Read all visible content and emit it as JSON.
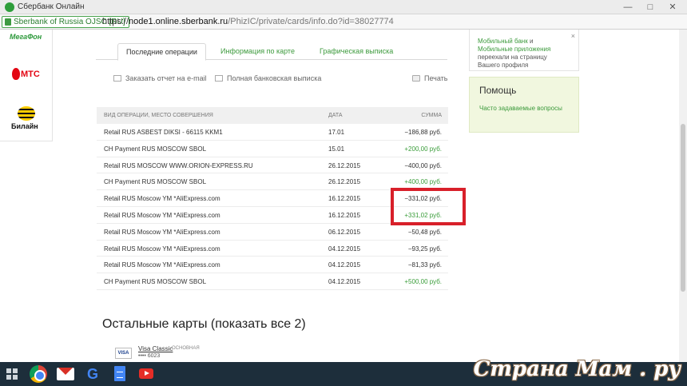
{
  "window": {
    "title": "Сбербанк Онлайн",
    "controls": {
      "minimize": "—",
      "maximize": "□",
      "close": "✕"
    }
  },
  "address_bar": {
    "security_badge": "Sberbank of Russia OJSC [RU]",
    "url_scheme": "https://",
    "url_host": "node1.online.sberbank.ru",
    "url_path": "/PhizIC/private/cards/info.do?id=38027774"
  },
  "ads": {
    "megafon": "МегаФон",
    "mts": "МТС",
    "beeline": "Билайн"
  },
  "tabs": [
    {
      "label": "Последние операции",
      "active": true
    },
    {
      "label": "Информация по карте",
      "active": false
    },
    {
      "label": "Графическая выписка",
      "active": false
    }
  ],
  "actions": {
    "email_report": "Заказать отчет на e-mail",
    "full_statement": "Полная банковская выписка",
    "print": "Печать"
  },
  "table": {
    "headers": {
      "operation": "ВИД ОПЕРАЦИИ, МЕСТО СОВЕРШЕНИЯ",
      "date": "ДАТА",
      "amount": "СУММА"
    },
    "rows": [
      {
        "operation": "Retail RUS ASBEST DIKSI - 66115 KKM1",
        "date": "17.01",
        "amount": "−186,88 руб.",
        "positive": false
      },
      {
        "operation": "CH Payment RUS MOSCOW SBOL",
        "date": "15.01",
        "amount": "+200,00 руб.",
        "positive": true
      },
      {
        "operation": "Retail RUS MOSCOW WWW.ORION-EXPRESS.RU",
        "date": "26.12.2015",
        "amount": "−400,00 руб.",
        "positive": false
      },
      {
        "operation": "CH Payment RUS MOSCOW SBOL",
        "date": "26.12.2015",
        "amount": "+400,00 руб.",
        "positive": true
      },
      {
        "operation": "Retail RUS Moscow YM *AliExpress.com",
        "date": "16.12.2015",
        "amount": "−331,02 руб.",
        "positive": false
      },
      {
        "operation": "Retail RUS Moscow YM *AliExpress.com",
        "date": "16.12.2015",
        "amount": "+331,02 руб.",
        "positive": true
      },
      {
        "operation": "Retail RUS Moscow YM *AliExpress.com",
        "date": "06.12.2015",
        "amount": "−50,48 руб.",
        "positive": false
      },
      {
        "operation": "Retail RUS Moscow YM *AliExpress.com",
        "date": "04.12.2015",
        "amount": "−93,25 руб.",
        "positive": false
      },
      {
        "operation": "Retail RUS Moscow YM *AliExpress.com",
        "date": "04.12.2015",
        "amount": "−81,33 руб.",
        "positive": false
      },
      {
        "operation": "CH Payment RUS MOSCOW SBOL",
        "date": "04.12.2015",
        "amount": "+500,00 руб.",
        "positive": true
      }
    ]
  },
  "info_box": {
    "link1": "Мобильный банк",
    "and": " и ",
    "link2": "Мобильные приложения",
    "text": " переехали на страницу Вашего профиля",
    "close": "×"
  },
  "help": {
    "title": "Помощь",
    "faq": "Часто задаваемые вопросы"
  },
  "other_cards": {
    "title": "Остальные карты (показать все 2)",
    "card": {
      "logo": "VISA",
      "name": "Visa Classic",
      "type": "ОСНОВНАЯ",
      "number": "•••• 6023"
    }
  },
  "taskbar": {
    "icons": [
      "windows-start-icon",
      "chrome-icon",
      "gmail-icon",
      "google-icon",
      "docs-icon",
      "youtube-icon"
    ],
    "google_letter": "G"
  },
  "watermark": "Страна Мам . ру",
  "colors": {
    "accent_green": "#3c9a3c",
    "highlight_red": "#d8202a",
    "help_bg": "#f1f7df"
  }
}
